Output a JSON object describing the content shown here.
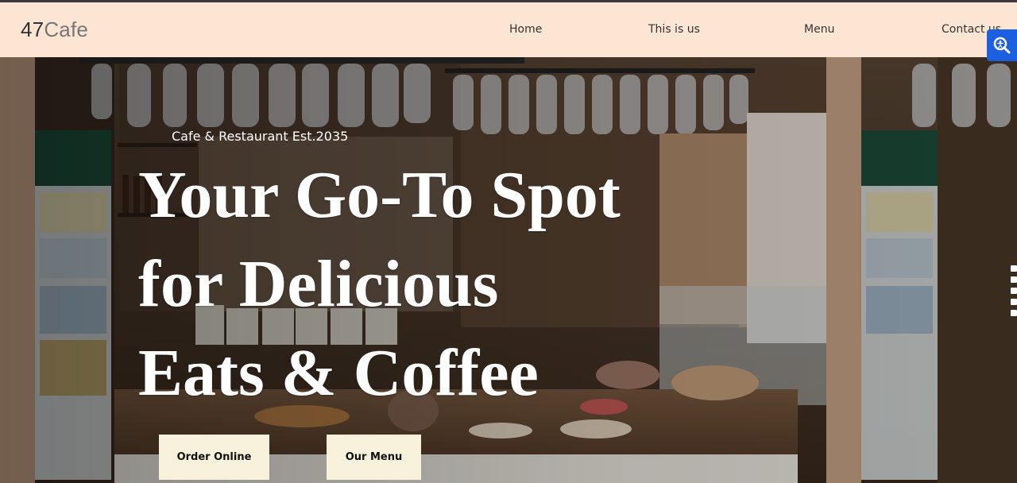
{
  "header": {
    "brand_number": "47",
    "brand_word": "Cafe",
    "nav": [
      {
        "label": "Home"
      },
      {
        "label": "This is us"
      },
      {
        "label": "Menu"
      },
      {
        "label": "Contact us"
      }
    ]
  },
  "accessibility": {
    "icon": "accessibility-magnifier-icon",
    "color": "#1c5fe0"
  },
  "hero": {
    "tagline": "Cafe & Restaurant Est.2035",
    "headline_lines": [
      "Your Go-To Spot",
      "for Delicious",
      "Eats & Coffee"
    ],
    "buttons": {
      "order": "Order Online",
      "menu": "Our Menu"
    }
  },
  "colors": {
    "navbar_bg": "#fde5d4",
    "button_bg": "#f7f1dc"
  }
}
